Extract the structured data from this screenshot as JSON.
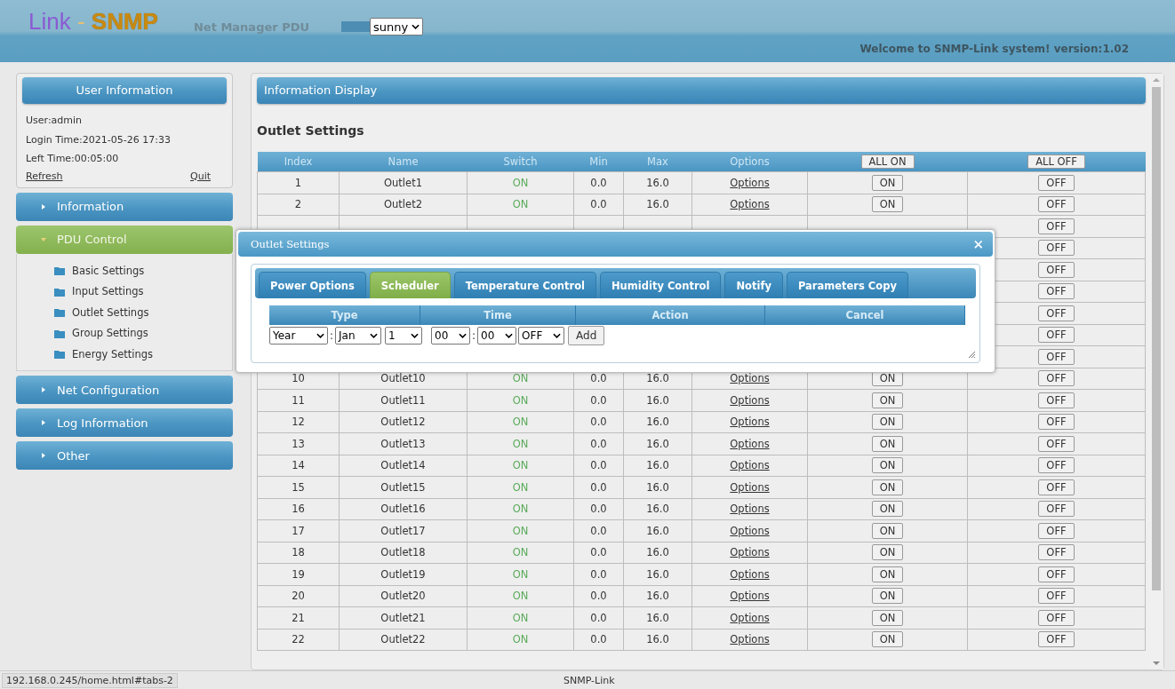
{
  "header": {
    "logo_part1": "Link",
    "logo_sep": "-",
    "logo_part2": "SNMP",
    "subtitle": "Net Manager PDU",
    "theme_select": "sunny",
    "welcome": "Welcome to SNMP-Link system! version:1.02"
  },
  "user_panel": {
    "title": "User Information",
    "lines": [
      "User:admin",
      "Login Time:2021-05-26 17:33",
      "Left Time:00:05:00"
    ],
    "refresh": "Refresh",
    "quit": "Quit"
  },
  "sidebar": {
    "items": [
      {
        "label": "Information",
        "expanded": false
      },
      {
        "label": "PDU Control",
        "expanded": true,
        "children": [
          {
            "label": "Basic Settings"
          },
          {
            "label": "Input Settings"
          },
          {
            "label": "Outlet Settings"
          },
          {
            "label": "Group Settings"
          },
          {
            "label": "Energy Settings"
          }
        ]
      },
      {
        "label": "Net Configuration",
        "expanded": false
      },
      {
        "label": "Log Information",
        "expanded": false
      },
      {
        "label": "Other",
        "expanded": false
      }
    ]
  },
  "main": {
    "panel_title": "Information Display",
    "section_title": "Outlet Settings",
    "table": {
      "columns": [
        "Index",
        "Name",
        "Switch",
        "Min",
        "Max",
        "Options"
      ],
      "all_on": "ALL ON",
      "all_off": "ALL OFF",
      "rows": [
        {
          "index": "1",
          "name": "Outlet1",
          "switch": "ON",
          "min": "0.0",
          "max": "16.0",
          "options": "Options",
          "on": "ON",
          "off": "OFF"
        },
        {
          "index": "2",
          "name": "Outlet2",
          "switch": "ON",
          "min": "0.0",
          "max": "16.0",
          "options": "Options",
          "on": "ON",
          "off": "OFF"
        },
        {
          "off": "OFF"
        },
        {
          "off": "OFF"
        },
        {
          "off": "OFF"
        },
        {
          "off": "OFF"
        },
        {
          "off": "OFF"
        },
        {
          "off": "OFF"
        },
        {
          "off": "OFF"
        },
        {
          "index": "10",
          "name": "Outlet10",
          "switch": "ON",
          "min": "0.0",
          "max": "16.0",
          "options": "Options",
          "on": "ON",
          "off": "OFF"
        },
        {
          "index": "11",
          "name": "Outlet11",
          "switch": "ON",
          "min": "0.0",
          "max": "16.0",
          "options": "Options",
          "on": "ON",
          "off": "OFF"
        },
        {
          "index": "12",
          "name": "Outlet12",
          "switch": "ON",
          "min": "0.0",
          "max": "16.0",
          "options": "Options",
          "on": "ON",
          "off": "OFF"
        },
        {
          "index": "13",
          "name": "Outlet13",
          "switch": "ON",
          "min": "0.0",
          "max": "16.0",
          "options": "Options",
          "on": "ON",
          "off": "OFF"
        },
        {
          "index": "14",
          "name": "Outlet14",
          "switch": "ON",
          "min": "0.0",
          "max": "16.0",
          "options": "Options",
          "on": "ON",
          "off": "OFF"
        },
        {
          "index": "15",
          "name": "Outlet15",
          "switch": "ON",
          "min": "0.0",
          "max": "16.0",
          "options": "Options",
          "on": "ON",
          "off": "OFF"
        },
        {
          "index": "16",
          "name": "Outlet16",
          "switch": "ON",
          "min": "0.0",
          "max": "16.0",
          "options": "Options",
          "on": "ON",
          "off": "OFF"
        },
        {
          "index": "17",
          "name": "Outlet17",
          "switch": "ON",
          "min": "0.0",
          "max": "16.0",
          "options": "Options",
          "on": "ON",
          "off": "OFF"
        },
        {
          "index": "18",
          "name": "Outlet18",
          "switch": "ON",
          "min": "0.0",
          "max": "16.0",
          "options": "Options",
          "on": "ON",
          "off": "OFF"
        },
        {
          "index": "19",
          "name": "Outlet19",
          "switch": "ON",
          "min": "0.0",
          "max": "16.0",
          "options": "Options",
          "on": "ON",
          "off": "OFF"
        },
        {
          "index": "20",
          "name": "Outlet20",
          "switch": "ON",
          "min": "0.0",
          "max": "16.0",
          "options": "Options",
          "on": "ON",
          "off": "OFF"
        },
        {
          "index": "21",
          "name": "Outlet21",
          "switch": "ON",
          "min": "0.0",
          "max": "16.0",
          "options": "Options",
          "on": "ON",
          "off": "OFF"
        },
        {
          "index": "22",
          "name": "Outlet22",
          "switch": "ON",
          "min": "0.0",
          "max": "16.0",
          "options": "Options",
          "on": "ON",
          "off": "OFF"
        }
      ]
    }
  },
  "dialog": {
    "title": "Outlet Settings",
    "close": "×",
    "tabs": [
      {
        "label": "Power Options",
        "selected": false
      },
      {
        "label": "Scheduler",
        "selected": true
      },
      {
        "label": "Temperature Control",
        "selected": false
      },
      {
        "label": "Humidity Control",
        "selected": false
      },
      {
        "label": "Notify",
        "selected": false
      },
      {
        "label": "Parameters Copy",
        "selected": false
      }
    ],
    "columns": [
      "Type",
      "Time",
      "Action",
      "Cancel"
    ],
    "selects": [
      {
        "value": "Year",
        "sep": ":"
      },
      {
        "value": "Jan"
      },
      {
        "value": "1"
      },
      {
        "value": "00",
        "sep": ":"
      },
      {
        "value": "00"
      },
      {
        "value": "OFF"
      }
    ],
    "add": "Add"
  },
  "status_bar": {
    "url": "192.168.0.245/home.html#tabs-2",
    "center": "SNMP-Link"
  }
}
